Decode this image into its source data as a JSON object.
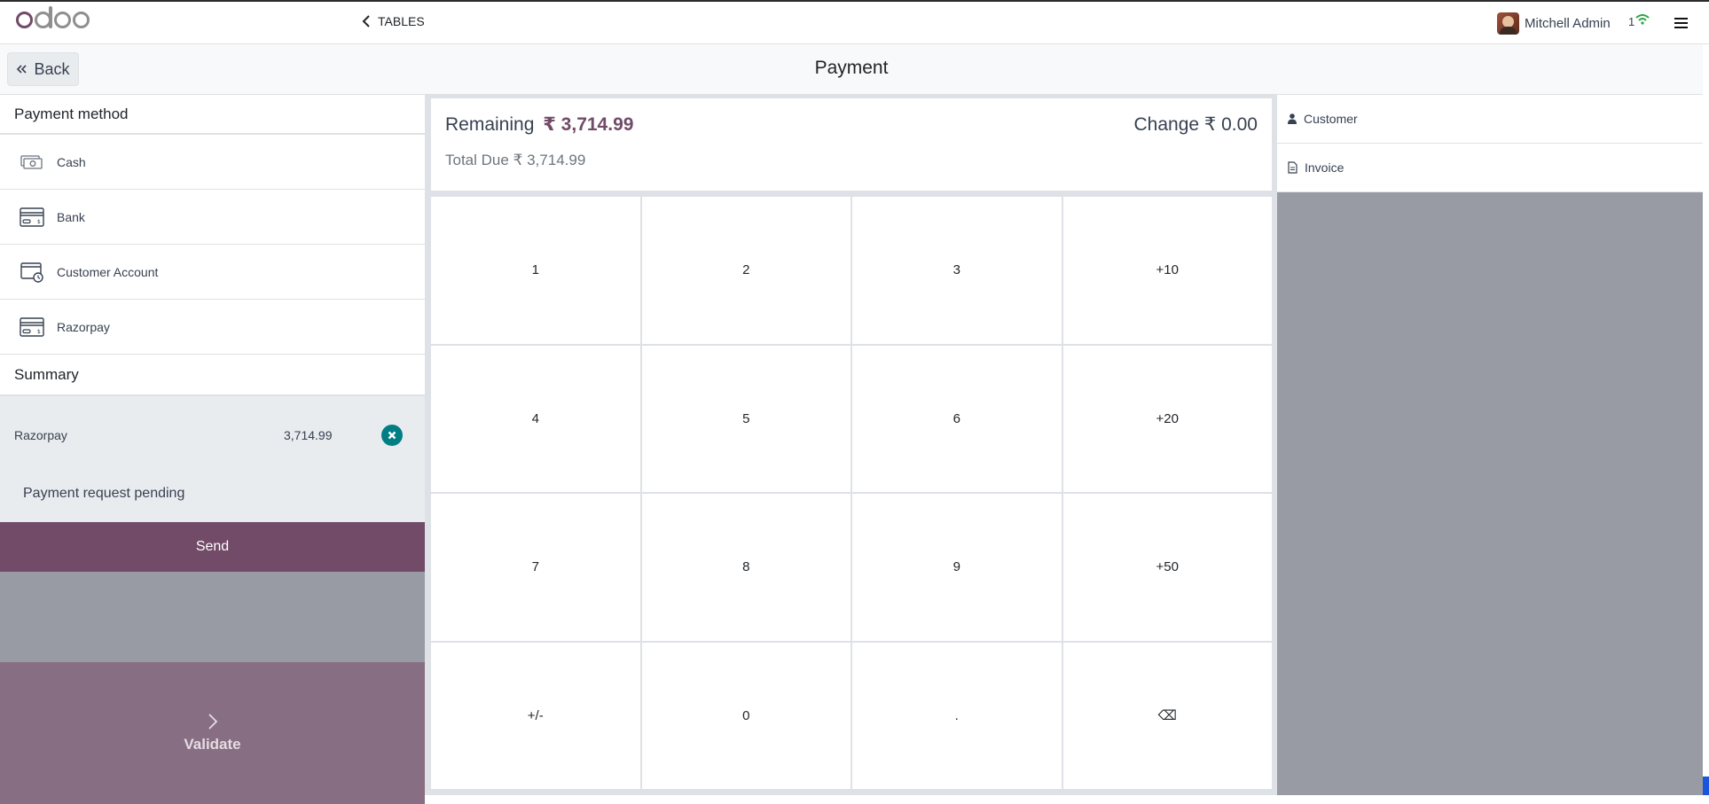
{
  "topbar": {
    "tables_label": "TABLES",
    "user_name": "Mitchell Admin",
    "status_count": "1"
  },
  "subheader": {
    "back_label": "Back",
    "title": "Payment"
  },
  "left": {
    "payment_method_title": "Payment method",
    "methods": [
      {
        "label": "Cash",
        "icon": "cash-icon"
      },
      {
        "label": "Bank",
        "icon": "bank-card-icon"
      },
      {
        "label": "Customer Account",
        "icon": "customer-account-icon"
      },
      {
        "label": "Razorpay",
        "icon": "razorpay-card-icon"
      }
    ],
    "summary_title": "Summary",
    "summary_line": {
      "method": "Razorpay",
      "amount": "3,714.99"
    },
    "pending_text": "Payment request pending",
    "send_label": "Send",
    "validate_label": "Validate"
  },
  "center": {
    "remaining_label": "Remaining",
    "remaining_value": "₹ 3,714.99",
    "change_label": "Change",
    "change_value": "₹ 0.00",
    "total_due_label": "Total Due",
    "total_due_value": "₹ 3,714.99",
    "keys": [
      "1",
      "2",
      "3",
      "+10",
      "4",
      "5",
      "6",
      "+20",
      "7",
      "8",
      "9",
      "+50",
      "+/-",
      "0",
      ".",
      "⌫"
    ]
  },
  "right": {
    "customer_label": "Customer",
    "invoice_label": "Invoice"
  },
  "colors": {
    "brand": "#714b67",
    "accent_teal": "#017e84",
    "panel_gray": "#999ba4"
  }
}
